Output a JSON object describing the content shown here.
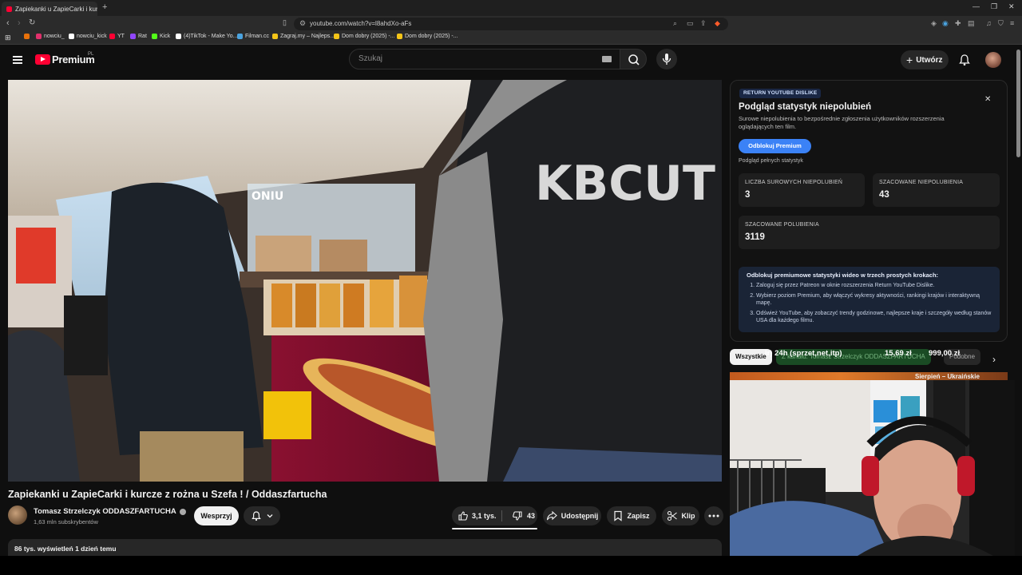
{
  "browser": {
    "tab_title": "Zapiekanki u ZapieCarki i kur",
    "url": "youtube.com/watch?v=l8ahdXo-aFs",
    "bookmarks": [
      {
        "label": "",
        "color": "#e8710a"
      },
      {
        "label": "nowciu_",
        "color": "#e1306c"
      },
      {
        "label": "nowciu_kick",
        "color": "#ffffff"
      },
      {
        "label": "YT",
        "color": "#ff0033"
      },
      {
        "label": "Rat",
        "color": "#9146ff"
      },
      {
        "label": "Kick",
        "color": "#53fc18"
      },
      {
        "label": "(4)TikTok - Make Yo...",
        "color": "#ffffff"
      },
      {
        "label": "Filman.cc",
        "color": "#4aa3df"
      },
      {
        "label": "Zagraj.my – Najleps...",
        "color": "#f5c518"
      },
      {
        "label": "Dom dobry (2025) -...",
        "color": "#f5c518"
      },
      {
        "label": "Dom dobry (2025) -...",
        "color": "#f5c518"
      }
    ]
  },
  "masthead": {
    "brand": "Premium",
    "country": "PL",
    "search_placeholder": "Szukaj",
    "create_label": "Utwórz"
  },
  "player": {
    "jacket_text": "KBCUT",
    "sign_text": "ONIU"
  },
  "video": {
    "title": "Zapiekanki u ZapieCarki i kurcze z rożna u Szefa ! / Oddaszfartucha",
    "channel": "Tomasz Strzelczyk ODDASZFARTUCHA",
    "subscribers": "1,63 mln subskrybentów",
    "support_label": "Wesprzyj",
    "likes": "3,1 tys.",
    "dislikes": "43",
    "share_label": "Udostępnij",
    "save_label": "Zapisz",
    "clip_label": "Klip",
    "views_date": "86 tys. wyświetleń  1 dzień temu"
  },
  "ryd": {
    "badge": "RETURN YOUTUBE DISLIKE",
    "title": "Podgląd statystyk niepolubień",
    "description": "Surowe niepolubienia to bezpośrednie zgłoszenia użytkowników rozszerzenia oglądających ten film.",
    "unlock_label": "Odblokuj Premium",
    "note": "Podgląd pełnych statystyk",
    "raw_dislikes_label": "LICZBA SUROWYCH NIEPOLUBIEŃ",
    "raw_dislikes": "3",
    "est_dislikes_label": "SZACOWANE NIEPOLUBIENIA",
    "est_dislikes": "43",
    "est_likes_label": "SZACOWANE POLUBIENIA",
    "est_likes": "3119",
    "steps_head": "Odblokuj premiumowe statystyki wideo w trzech prostych krokach:",
    "steps": [
      "Zaloguj się przez Patreon w oknie rozszerzenia Return YouTube Dislike.",
      "Wybierz poziom Premium, aby włączyć wykresy aktywności, rankingi krajów i interaktywną mapę.",
      "Odśwież YouTube, aby zobaczyć trendy godzinowe, najlepsze kraje i szczegóły według stanów USA dla każdego filmu."
    ]
  },
  "chips": {
    "all": "Wszystkie",
    "channel": "Z kanału: Tomasz Strzelczyk ODDASZFARTUCHA",
    "related": "Podobne"
  },
  "overlay": {
    "item": "ir) 24h (sprzet,net,itp)",
    "amount": "15,69 zł",
    "goal": "999,00 zł"
  },
  "related": {
    "title": "Sierpień – Ukraińskie"
  },
  "colors": {
    "accent_red": "#ff0033",
    "ryd_blue": "#3b82f6",
    "background": "#0f0f0f"
  }
}
